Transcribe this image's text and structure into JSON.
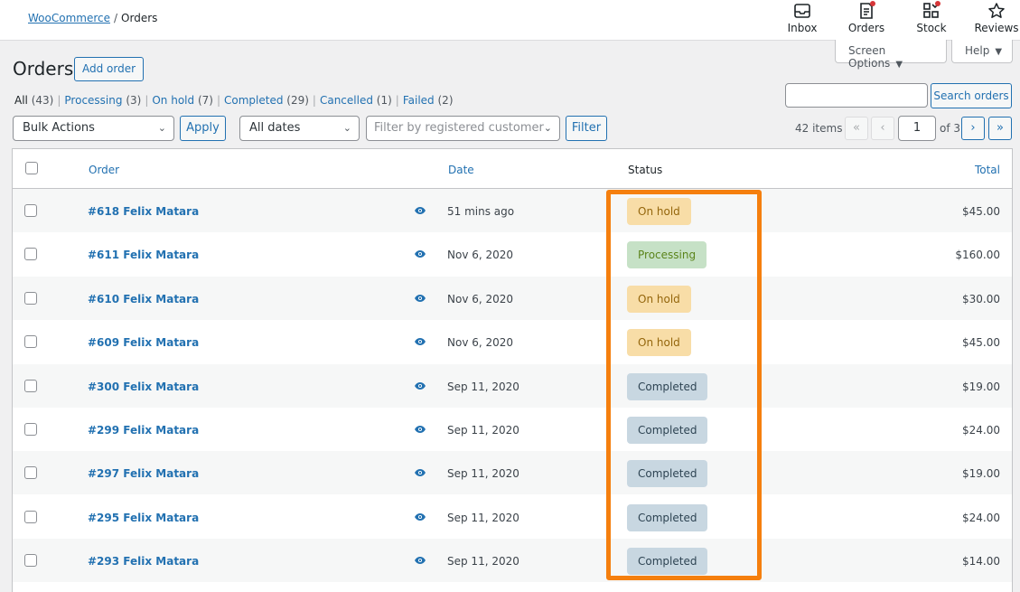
{
  "breadcrumb": {
    "parent": "WooCommerce",
    "separator": "/",
    "current": "Orders"
  },
  "activity": [
    {
      "label": "Inbox",
      "icon": "inbox-icon",
      "dot": false
    },
    {
      "label": "Orders",
      "icon": "orders-icon",
      "dot": true
    },
    {
      "label": "Stock",
      "icon": "stock-icon",
      "dot": true
    },
    {
      "label": "Reviews",
      "icon": "star-icon",
      "dot": false
    }
  ],
  "screen_options": {
    "label": "Screen Options"
  },
  "help": {
    "label": "Help"
  },
  "page": {
    "title": "Orders",
    "add_label": "Add order"
  },
  "status_filters": [
    {
      "label": "All",
      "count": "(43)",
      "current": true
    },
    {
      "label": "Processing",
      "count": "(3)"
    },
    {
      "label": "On hold",
      "count": "(7)"
    },
    {
      "label": "Completed",
      "count": "(29)"
    },
    {
      "label": "Cancelled",
      "count": "(1)"
    },
    {
      "label": "Failed",
      "count": "(2)"
    }
  ],
  "search": {
    "button": "Search orders",
    "value": ""
  },
  "tablenav": {
    "bulk_actions": "Bulk Actions",
    "apply": "Apply",
    "dates": "All dates",
    "customer_placeholder": "Filter by registered customer",
    "filter": "Filter",
    "items": "42 items",
    "first": "«",
    "prev": "‹",
    "page": "1",
    "of": "of 3",
    "next": "›",
    "last": "»"
  },
  "columns": {
    "order": "Order",
    "date": "Date",
    "status": "Status",
    "total": "Total"
  },
  "orders": [
    {
      "order": "#618 Felix Matara",
      "date": "51 mins ago",
      "status": "On hold",
      "status_key": "on-hold",
      "total": "$45.00"
    },
    {
      "order": "#611 Felix Matara",
      "date": "Nov 6, 2020",
      "status": "Processing",
      "status_key": "processing",
      "total": "$160.00"
    },
    {
      "order": "#610 Felix Matara",
      "date": "Nov 6, 2020",
      "status": "On hold",
      "status_key": "on-hold",
      "total": "$30.00"
    },
    {
      "order": "#609 Felix Matara",
      "date": "Nov 6, 2020",
      "status": "On hold",
      "status_key": "on-hold",
      "total": "$45.00"
    },
    {
      "order": "#300 Felix Matara",
      "date": "Sep 11, 2020",
      "status": "Completed",
      "status_key": "completed",
      "total": "$19.00"
    },
    {
      "order": "#299 Felix Matara",
      "date": "Sep 11, 2020",
      "status": "Completed",
      "status_key": "completed",
      "total": "$24.00"
    },
    {
      "order": "#297 Felix Matara",
      "date": "Sep 11, 2020",
      "status": "Completed",
      "status_key": "completed",
      "total": "$19.00"
    },
    {
      "order": "#295 Felix Matara",
      "date": "Sep 11, 2020",
      "status": "Completed",
      "status_key": "completed",
      "total": "$24.00"
    },
    {
      "order": "#293 Felix Matara",
      "date": "Sep 11, 2020",
      "status": "Completed",
      "status_key": "completed",
      "total": "$14.00"
    }
  ],
  "colors": {
    "link": "#2271b1",
    "highlight": "#f57f0e",
    "on_hold": "#f8dda7",
    "processing": "#c6e1c6",
    "completed": "#c8d7e1"
  }
}
